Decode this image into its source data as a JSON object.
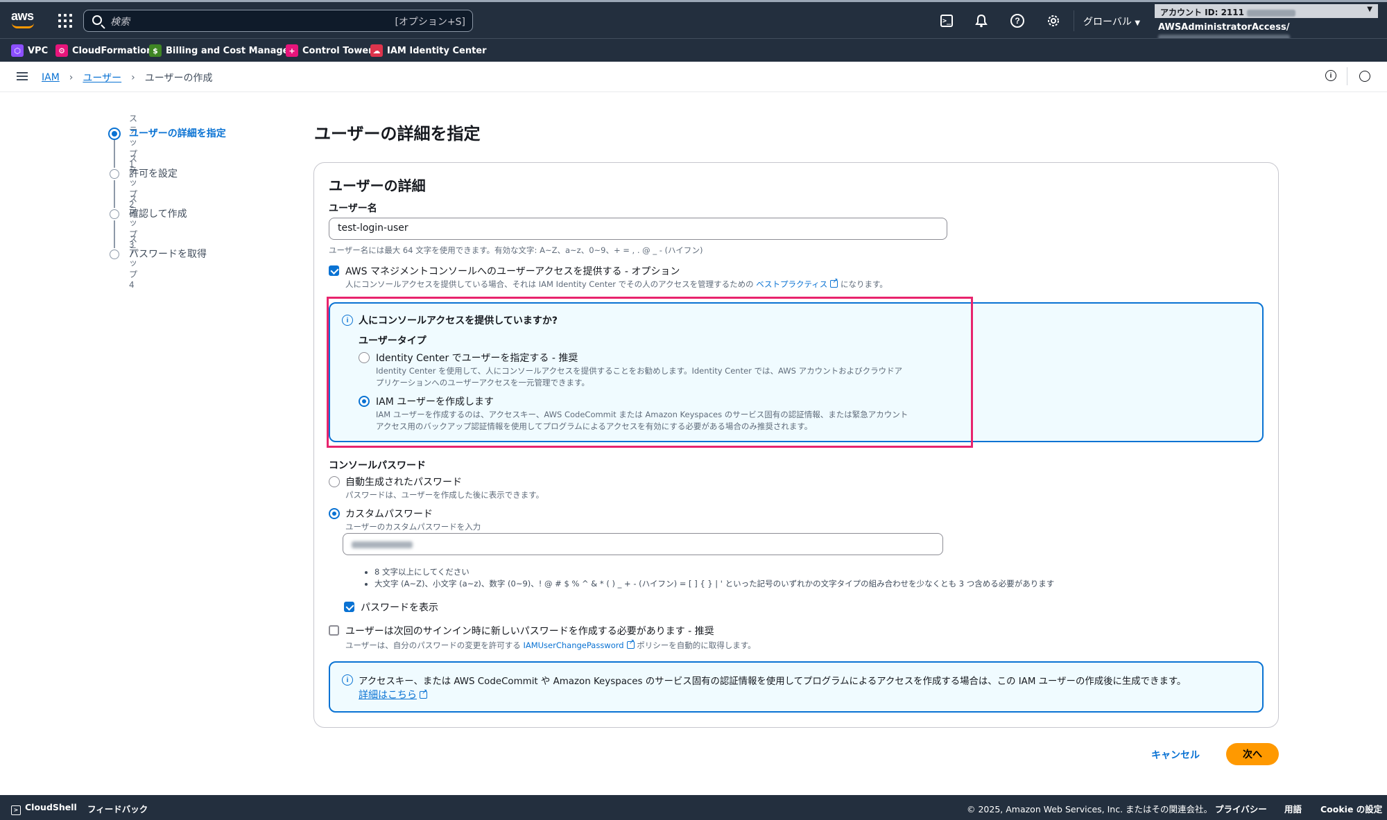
{
  "topbar": {
    "logo": "aws",
    "search_placeholder": "検索",
    "search_shortcut": "[オプション+S]",
    "region": "グローバル",
    "account_label": "アカウント ID: 2111",
    "role_label": "AWSAdministratorAccess/"
  },
  "favorites": [
    {
      "label": "VPC",
      "color": "#8c4fff"
    },
    {
      "label": "CloudFormation",
      "color": "#e7157b"
    },
    {
      "label": "Billing and Cost Manage...",
      "color": "#3f8624"
    },
    {
      "label": "Control Tower",
      "color": "#e7157b"
    },
    {
      "label": "IAM Identity Center",
      "color": "#dd344c"
    }
  ],
  "breadcrumb": {
    "items": [
      "IAM",
      "ユーザー"
    ],
    "current": "ユーザーの作成"
  },
  "steps": [
    {
      "num": "ステップ 1",
      "label": "ユーザーの詳細を指定",
      "active": true
    },
    {
      "num": "ステップ 2",
      "label": "許可を設定",
      "active": false
    },
    {
      "num": "ステップ 3",
      "label": "確認して作成",
      "active": false
    },
    {
      "num": "ステップ 4",
      "label": "パスワードを取得",
      "active": false
    }
  ],
  "page_title": "ユーザーの詳細を指定",
  "details": {
    "heading": "ユーザーの詳細",
    "username_label": "ユーザー名",
    "username_value": "test-login-user",
    "username_hint": "ユーザー名には最大 64 文字を使用できます。有効な文字: A~Z、a~z、0~9、+ = , . @ _ - (ハイフン)",
    "console_access_label": "AWS マネジメントコンソールへのユーザーアクセスを提供する - オプション",
    "console_access_hint_pre": "人にコンソールアクセスを提供している場合、それは IAM Identity Center でその人のアクセスを管理するための",
    "console_access_hint_link": "ベストプラクティス",
    "console_access_hint_post": "になります。"
  },
  "user_type_box": {
    "question": "人にコンソールアクセスを提供していますか?",
    "user_type_label": "ユーザータイプ",
    "option1_label": "Identity Center でユーザーを指定する - 推奨",
    "option1_desc_1": "Identity Center を使用して、人にコンソールアクセスを提供することをお勧めします。Identity Center では、AWS アカウントおよびクラウドア",
    "option1_desc_2": "プリケーションへのユーザーアクセスを一元管理できます。",
    "option2_label": "IAM ユーザーを作成します",
    "option2_desc_1": "IAM ユーザーを作成するのは、アクセスキー、AWS CodeCommit または Amazon Keyspaces のサービス固有の認証情報、または緊急アカウント",
    "option2_desc_2": "アクセス用のバックアップ認証情報を使用してプログラムによるアクセスを有効にする必要がある場合のみ推奨されます。"
  },
  "password": {
    "label": "コンソールパスワード",
    "auto_label": "自動生成されたパスワード",
    "auto_hint": "パスワードは、ユーザーを作成した後に表示できます。",
    "custom_label": "カスタムパスワード",
    "custom_hint": "ユーザーのカスタムパスワードを入力",
    "rule_1": "8 文字以上にしてください",
    "rule_2": "大文字 (A~Z)、小文字 (a~z)、数字 (0~9)、! @ # $ % ^ & * ( ) _ + - (ハイフン) = [ ] { } | ' といった記号のいずれかの文字タイプの組み合わせを少なくとも 3 つ含める必要があります",
    "show_label": "パスワードを表示",
    "reset_label": "ユーザーは次回のサインイン時に新しいパスワードを作成する必要があります - 推奨",
    "reset_hint_pre": "ユーザーは、自分のパスワードの変更を許可する",
    "reset_hint_link": "IAMUserChangePassword",
    "reset_hint_post": "ポリシーを自動的に取得します。"
  },
  "access_key_box": {
    "text": "アクセスキー、または AWS CodeCommit や Amazon Keyspaces のサービス固有の認証情報を使用してプログラムによるアクセスを作成する場合は、この IAM ユーザーの作成後に生成できます。",
    "link": "詳細はこちら"
  },
  "actions": {
    "cancel": "キャンセル",
    "next": "次へ"
  },
  "footer": {
    "cloudshell": "CloudShell",
    "feedback": "フィードバック",
    "copyright": "© 2025, Amazon Web Services, Inc. またはその関連会社。",
    "privacy": "プライバシー",
    "terms": "用語",
    "cookie": "Cookie の設定"
  },
  "colors": {
    "accent": "#0972d3",
    "primary_button": "#ff9900",
    "nav_bg": "#232f3e",
    "highlight_border": "#e8246d"
  }
}
